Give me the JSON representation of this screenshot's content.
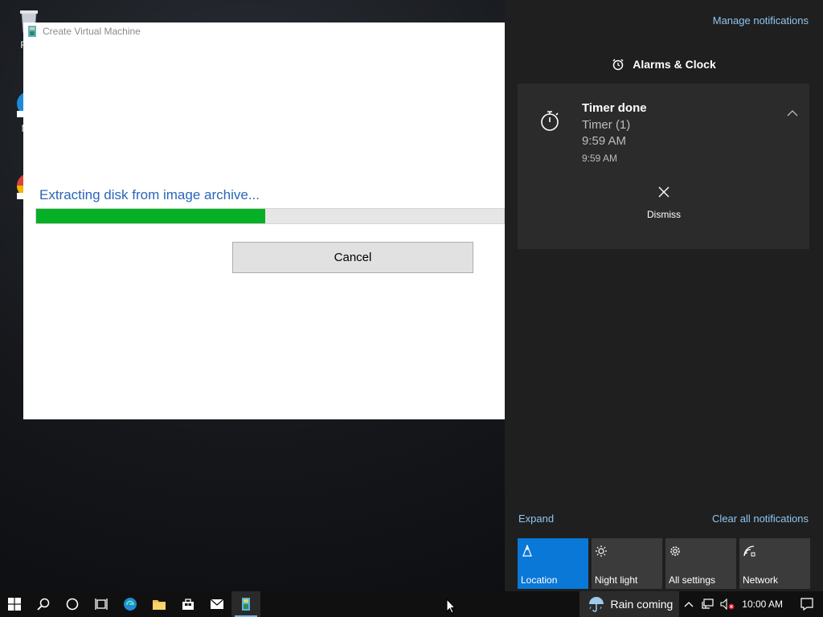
{
  "desktop": {
    "icons": [
      {
        "label": "Rec"
      },
      {
        "label": "Mic"
      },
      {
        "label": "Gc"
      }
    ]
  },
  "vm_window": {
    "title": "Create Virtual Machine",
    "status_text": "Extracting disk from image archive...",
    "progress_percent": 49,
    "cancel_label": "Cancel"
  },
  "action_center": {
    "manage_label": "Manage notifications",
    "group_title": "Alarms & Clock",
    "notification": {
      "title": "Timer done",
      "line1": "Timer (1)",
      "line2": "9:59 AM",
      "timestamp": "9:59 AM",
      "dismiss_label": "Dismiss"
    },
    "expand_label": "Expand",
    "clear_label": "Clear all notifications",
    "quick_actions": [
      {
        "label": "Location",
        "icon": "location-icon",
        "active": true
      },
      {
        "label": "Night light",
        "icon": "brightness-icon",
        "active": false
      },
      {
        "label": "All settings",
        "icon": "gear-icon",
        "active": false
      },
      {
        "label": "Network",
        "icon": "network-icon",
        "active": false
      }
    ]
  },
  "taskbar": {
    "weather_text": "Rain coming",
    "clock": "10:00 AM"
  },
  "colors": {
    "accent": "#0a78d7",
    "progress": "#06b025",
    "link": "#8fc6f2",
    "status_text": "#2a66b8"
  }
}
